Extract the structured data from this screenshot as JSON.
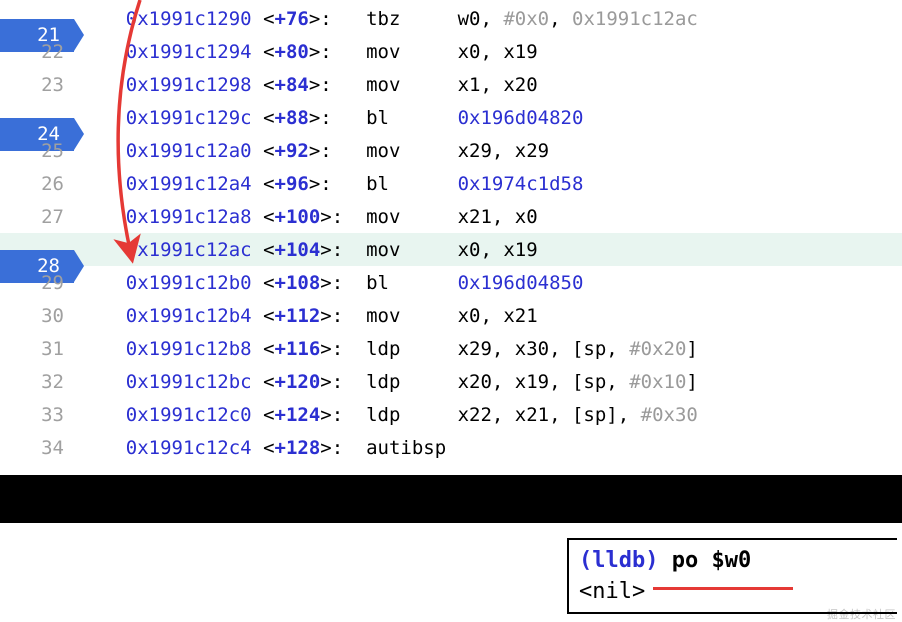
{
  "lines": [
    {
      "num": "21",
      "bp": true,
      "hi": false,
      "addr": "0x1991c1290",
      "offset": "+76",
      "mnem": "tbz",
      "ops": [
        {
          "t": "txt",
          "v": "w0, "
        },
        {
          "t": "imm",
          "v": "#0x0"
        },
        {
          "t": "txt",
          "v": ", "
        },
        {
          "t": "imm",
          "v": "0x1991c12ac"
        }
      ]
    },
    {
      "num": "22",
      "bp": false,
      "hi": false,
      "addr": "0x1991c1294",
      "offset": "+80",
      "mnem": "mov",
      "ops": [
        {
          "t": "txt",
          "v": "x0, x19"
        }
      ]
    },
    {
      "num": "23",
      "bp": false,
      "hi": false,
      "addr": "0x1991c1298",
      "offset": "+84",
      "mnem": "mov",
      "ops": [
        {
          "t": "txt",
          "v": "x1, x20"
        }
      ]
    },
    {
      "num": "24",
      "bp": true,
      "hi": false,
      "addr": "0x1991c129c",
      "offset": "+88",
      "mnem": "bl",
      "ops": [
        {
          "t": "branch",
          "v": "0x196d04820"
        }
      ]
    },
    {
      "num": "25",
      "bp": false,
      "hi": false,
      "addr": "0x1991c12a0",
      "offset": "+92",
      "mnem": "mov",
      "ops": [
        {
          "t": "txt",
          "v": "x29, x29"
        }
      ]
    },
    {
      "num": "26",
      "bp": false,
      "hi": false,
      "addr": "0x1991c12a4",
      "offset": "+96",
      "mnem": "bl",
      "ops": [
        {
          "t": "branch",
          "v": "0x1974c1d58"
        }
      ]
    },
    {
      "num": "27",
      "bp": false,
      "hi": false,
      "addr": "0x1991c12a8",
      "offset": "+100",
      "mnem": "mov",
      "ops": [
        {
          "t": "txt",
          "v": "x21, x0"
        }
      ]
    },
    {
      "num": "28",
      "bp": true,
      "hi": true,
      "addr": "0x1991c12ac",
      "offset": "+104",
      "mnem": "mov",
      "ops": [
        {
          "t": "txt",
          "v": "x0, x19"
        }
      ]
    },
    {
      "num": "29",
      "bp": false,
      "hi": false,
      "addr": "0x1991c12b0",
      "offset": "+108",
      "mnem": "bl",
      "ops": [
        {
          "t": "branch",
          "v": "0x196d04850"
        }
      ]
    },
    {
      "num": "30",
      "bp": false,
      "hi": false,
      "addr": "0x1991c12b4",
      "offset": "+112",
      "mnem": "mov",
      "ops": [
        {
          "t": "txt",
          "v": "x0, x21"
        }
      ]
    },
    {
      "num": "31",
      "bp": false,
      "hi": false,
      "addr": "0x1991c12b8",
      "offset": "+116",
      "mnem": "ldp",
      "ops": [
        {
          "t": "txt",
          "v": "x29, x30, [sp, "
        },
        {
          "t": "imm",
          "v": "#0x20"
        },
        {
          "t": "txt",
          "v": "]"
        }
      ]
    },
    {
      "num": "32",
      "bp": false,
      "hi": false,
      "addr": "0x1991c12bc",
      "offset": "+120",
      "mnem": "ldp",
      "ops": [
        {
          "t": "txt",
          "v": "x20, x19, [sp, "
        },
        {
          "t": "imm",
          "v": "#0x10"
        },
        {
          "t": "txt",
          "v": "]"
        }
      ]
    },
    {
      "num": "33",
      "bp": false,
      "hi": false,
      "addr": "0x1991c12c0",
      "offset": "+124",
      "mnem": "ldp",
      "ops": [
        {
          "t": "txt",
          "v": "x22, x21, [sp], "
        },
        {
          "t": "imm",
          "v": "#0x30"
        }
      ]
    },
    {
      "num": "34",
      "bp": false,
      "hi": false,
      "addr": "0x1991c12c4",
      "offset": "+128",
      "mnem": "autibsp",
      "ops": []
    }
  ],
  "console": {
    "prompt": "lldb",
    "command": "po $w0",
    "output": "<nil>"
  },
  "watermark": "掘金技术社区"
}
